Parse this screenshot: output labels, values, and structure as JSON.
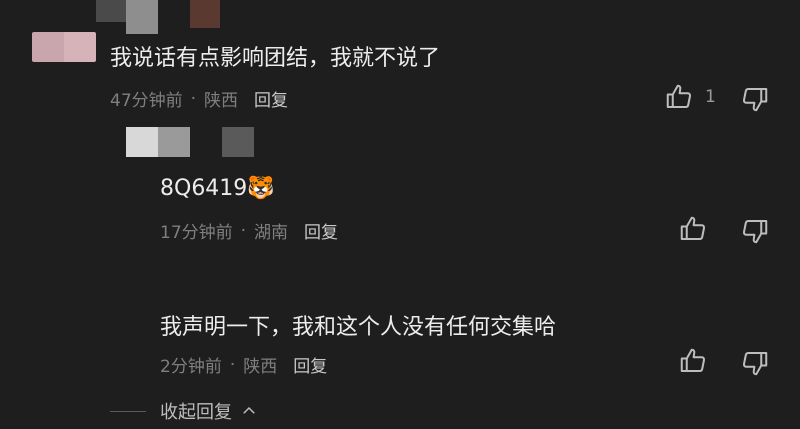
{
  "comments": [
    {
      "text": "我说话有点影响团结，我就不说了",
      "time": "47分钟前",
      "region": "陕西",
      "reply_label": "回复",
      "likes": "1"
    },
    {
      "text": "8Q6419",
      "emoji": "🐯",
      "time": "17分钟前",
      "region": "湖南",
      "reply_label": "回复"
    },
    {
      "text": "我声明一下，我和这个人没有任何交集哈",
      "time": "2分钟前",
      "region": "陕西",
      "reply_label": "回复"
    }
  ],
  "separator": "·",
  "collapse_label": "收起回复",
  "icons": [
    "thumbs-up-icon",
    "thumbs-down-icon",
    "chevron-up-icon"
  ],
  "colors": {
    "background": "#1e1e1e",
    "text": "#ececec",
    "meta": "#7f7f7f"
  }
}
